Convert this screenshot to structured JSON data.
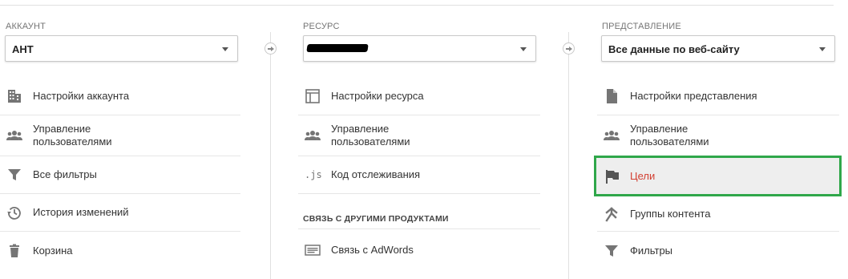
{
  "account": {
    "label": "АККАУНТ",
    "selected": "АНТ",
    "items": [
      {
        "label": "Настройки аккаунта",
        "icon": "building-icon"
      },
      {
        "label": "Управление\nпользователями",
        "icon": "users-icon"
      },
      {
        "label": "Все фильтры",
        "icon": "filter-icon"
      },
      {
        "label": "История изменений",
        "icon": "history-icon"
      },
      {
        "label": "Корзина",
        "icon": "trash-icon"
      }
    ]
  },
  "resource": {
    "label": "РЕСУРС",
    "selected": "",
    "items": [
      {
        "label": "Настройки ресурса",
        "icon": "settings-window-icon"
      },
      {
        "label": "Управление\nпользователями",
        "icon": "users-icon"
      },
      {
        "label": "Код отслеживания",
        "icon": "js-icon",
        "glyph": ".JS"
      }
    ],
    "section_heading": "СВЯЗЬ С ДРУГИМИ ПРОДУКТАМИ",
    "links": [
      {
        "label": "Связь с AdWords",
        "icon": "adwords-icon"
      }
    ]
  },
  "view": {
    "label": "ПРЕДСТАВЛЕНИЕ",
    "selected": "Все данные по веб-сайту",
    "items": [
      {
        "label": "Настройки представления",
        "icon": "document-icon"
      },
      {
        "label": "Управление\nпользователями",
        "icon": "users-icon"
      },
      {
        "label": "Цели",
        "icon": "flag-icon",
        "active": true
      },
      {
        "label": "Группы контента",
        "icon": "content-groups-icon"
      },
      {
        "label": "Фильтры",
        "icon": "filter-icon"
      }
    ]
  },
  "colors": {
    "active_border": "#2fa74a",
    "active_text": "#d23f31",
    "icon_gray": "#757575"
  }
}
